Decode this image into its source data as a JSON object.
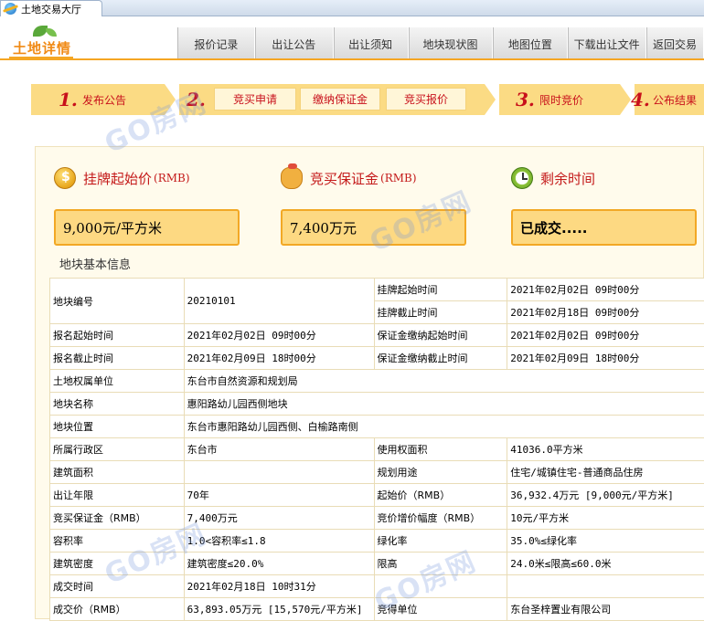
{
  "browser": {
    "tab_title": "土地交易大厅"
  },
  "header": {
    "logo_text": "土地详情",
    "nav": [
      "报价记录",
      "出让公告",
      "出让须知",
      "地块现状图",
      "地图位置",
      "下载出让文件",
      "返回交易"
    ]
  },
  "steps": {
    "s1_num": "1.",
    "s1_label": "发布公告",
    "s2_num": "2.",
    "s2_buttons": [
      "竞买申请",
      "缴纳保证金",
      "竞买报价"
    ],
    "s3_num": "3.",
    "s3_label": "限时竞价",
    "s4_num": "4.",
    "s4_label": "公布结果"
  },
  "summary": {
    "start_price_label": "挂牌起始价",
    "deposit_label": "竞买保证金",
    "rmb_suffix": "(RMB)",
    "remaining_label": "剩余时间",
    "start_price_value": "9,000元/平方米",
    "deposit_value": "7,400万元",
    "remaining_value": "已成交....."
  },
  "section_title": "地块基本信息",
  "info": {
    "parcel_no_label": "地块编号",
    "parcel_no": "20210101",
    "listing_start_label": "挂牌起始时间",
    "listing_start": "2021年02月02日 09时00分",
    "listing_end_label": "挂牌截止时间",
    "listing_end": "2021年02月18日 09时00分",
    "reg_start_label": "报名起始时间",
    "reg_start": "2021年02月02日 09时00分",
    "deposit_start_label": "保证金缴纳起始时间",
    "deposit_start": "2021年02月02日 09时00分",
    "reg_end_label": "报名截止时间",
    "reg_end": "2021年02月09日 18时00分",
    "deposit_end_label": "保证金缴纳截止时间",
    "deposit_end": "2021年02月09日 18时00分",
    "owner_label": "土地权属单位",
    "owner": "东台市自然资源和规划局",
    "name_label": "地块名称",
    "name": "惠阳路幼儿园西侧地块",
    "location_label": "地块位置",
    "location": "东台市惠阳路幼儿园西侧、白榆路南侧",
    "district_label": "所属行政区",
    "district": "东台市",
    "use_area_label": "使用权面积",
    "use_area": "41036.0平方米",
    "build_area_label": "建筑面积",
    "build_area": "",
    "plan_use_label": "规划用途",
    "plan_use": "住宅/城镇住宅-普通商品住房",
    "term_label": "出让年限",
    "term": "70年",
    "start_price_label": "起始价（RMB）",
    "start_price": "36,932.4万元 [9,000元/平方米]",
    "deposit_label": "竞买保证金（RMB）",
    "deposit": "7,400万元",
    "increment_label": "竞价增价幅度（RMB）",
    "increment": "10元/平方米",
    "far_label": "容积率",
    "far": "1.0<容积率≤1.8",
    "green_label": "绿化率",
    "green": "35.0%≤绿化率",
    "density_label": "建筑密度",
    "density": "建筑密度≤20.0%",
    "height_label": "限高",
    "height": "24.0米≤限高≤60.0米",
    "deal_time_label": "成交时间",
    "deal_time": "2021年02月18日 10时31分",
    "deal_price_label": "成交价（RMB）",
    "deal_price": "63,893.05万元 [15,570元/平方米]",
    "winner_label": "竞得单位",
    "winner": "东台圣梓置业有限公司"
  },
  "watermark": "GO房网"
}
